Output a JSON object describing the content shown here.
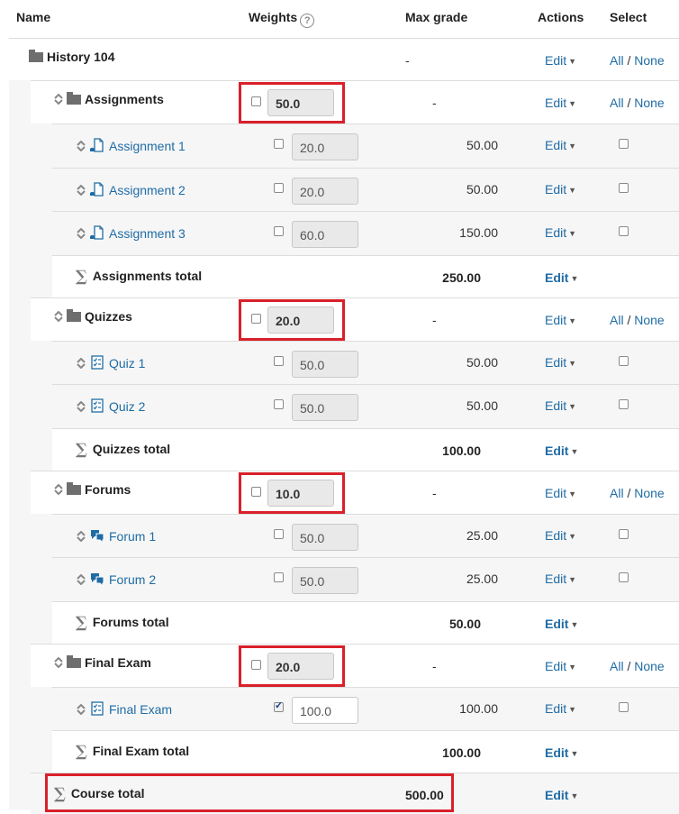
{
  "header": {
    "name": "Name",
    "weights": "Weights",
    "help": "?",
    "max_grade": "Max grade",
    "actions": "Actions",
    "select": "Select"
  },
  "course": {
    "name": "History 104",
    "max": "-",
    "edit": "Edit",
    "all": "All",
    "sep": " / ",
    "none": "None"
  },
  "categories": [
    {
      "name": "Assignments",
      "weight": "50.0",
      "max": "-",
      "edit": "Edit",
      "all": "All",
      "sep": " / ",
      "none": "None",
      "items": [
        {
          "name": "Assignment 1",
          "icon": "assignment-icon",
          "weight": "20.0",
          "max": "50.00",
          "edit": "Edit"
        },
        {
          "name": "Assignment 2",
          "icon": "assignment-icon",
          "weight": "20.0",
          "max": "50.00",
          "edit": "Edit"
        },
        {
          "name": "Assignment 3",
          "icon": "assignment-icon",
          "weight": "60.0",
          "max": "150.00",
          "edit": "Edit"
        }
      ],
      "total_label": "Assignments total",
      "total_max": "250.00",
      "total_edit": "Edit"
    },
    {
      "name": "Quizzes",
      "weight": "20.0",
      "max": "-",
      "edit": "Edit",
      "all": "All",
      "sep": " / ",
      "none": "None",
      "items": [
        {
          "name": "Quiz 1",
          "icon": "quiz-icon",
          "weight": "50.0",
          "max": "50.00",
          "edit": "Edit"
        },
        {
          "name": "Quiz 2",
          "icon": "quiz-icon",
          "weight": "50.0",
          "max": "50.00",
          "edit": "Edit"
        }
      ],
      "total_label": "Quizzes total",
      "total_max": "100.00",
      "total_edit": "Edit"
    },
    {
      "name": "Forums",
      "weight": "10.0",
      "max": "-",
      "edit": "Edit",
      "all": "All",
      "sep": " / ",
      "none": "None",
      "items": [
        {
          "name": "Forum 1",
          "icon": "forum-icon",
          "weight": "50.0",
          "max": "25.00",
          "edit": "Edit"
        },
        {
          "name": "Forum 2",
          "icon": "forum-icon",
          "weight": "50.0",
          "max": "25.00",
          "edit": "Edit"
        }
      ],
      "total_label": "Forums total",
      "total_max": "50.00",
      "total_edit": "Edit"
    },
    {
      "name": "Final Exam",
      "weight": "20.0",
      "max": "-",
      "edit": "Edit",
      "all": "All",
      "sep": " / ",
      "none": "None",
      "items": [
        {
          "name": "Final Exam",
          "icon": "quiz-icon",
          "weight": "100.0",
          "max": "100.00",
          "edit": "Edit",
          "checked": true
        }
      ],
      "total_label": "Final Exam total",
      "total_max": "100.00",
      "total_edit": "Edit"
    }
  ],
  "course_total": {
    "label": "Course total",
    "max": "500.00",
    "edit": "Edit"
  },
  "colors": {
    "link": "#1f6ca5",
    "highlight": "#d9202a",
    "row_alt": "#f6f6f6"
  }
}
